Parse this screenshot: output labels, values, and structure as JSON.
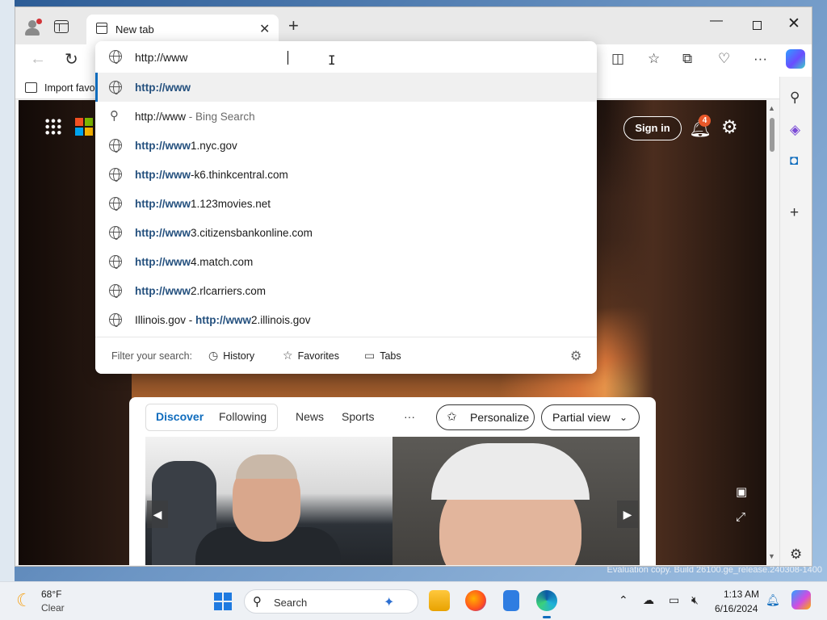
{
  "browser": {
    "tab_title": "New tab",
    "favorites_bar_label": "Import favo",
    "address_value": "http://www"
  },
  "suggestions": [
    {
      "bold": "http://www",
      "rest": "",
      "icon": "globe-icon"
    },
    {
      "bold": "",
      "rest": "http://www",
      "sub": " - Bing Search",
      "icon": "search-icon"
    },
    {
      "bold": "http://www",
      "rest": "1.nyc.gov",
      "icon": "globe-icon"
    },
    {
      "bold": "http://www",
      "rest": "-k6.thinkcentral.com",
      "icon": "globe-icon"
    },
    {
      "bold": "http://www",
      "rest": "1.123movies.net",
      "icon": "globe-icon"
    },
    {
      "bold": "http://www",
      "rest": "3.citizensbankonline.com",
      "icon": "globe-icon"
    },
    {
      "bold": "http://www",
      "rest": "4.match.com",
      "icon": "globe-icon"
    },
    {
      "bold": "http://www",
      "rest": "2.rlcarriers.com",
      "icon": "globe-icon"
    },
    {
      "prefix": "Illinois.gov - ",
      "bold": "http://www",
      "rest": "2.illinois.gov",
      "icon": "globe-icon"
    }
  ],
  "filter": {
    "label": "Filter your search:",
    "history": "History",
    "favorites": "Favorites",
    "tabs": "Tabs"
  },
  "page": {
    "sign_in": "Sign in",
    "notification_count": "4",
    "feed_tabs": [
      "Discover",
      "Following",
      "News",
      "Sports"
    ],
    "more": "···",
    "personalize": "Personalize",
    "partial_view": "Partial view"
  },
  "taskbar": {
    "weather_temp": "68°F",
    "weather_desc": "Clear",
    "search_label": "Search",
    "time": "1:13 AM",
    "date": "6/16/2024"
  },
  "desktop": {
    "eval_text": "Evaluation copy. Build 26100.ge_release.240308-1400"
  },
  "colors": {
    "accent": "#0f6cbd",
    "suggestion_bold": "#24507e",
    "notification_badge": "#e8582a"
  }
}
